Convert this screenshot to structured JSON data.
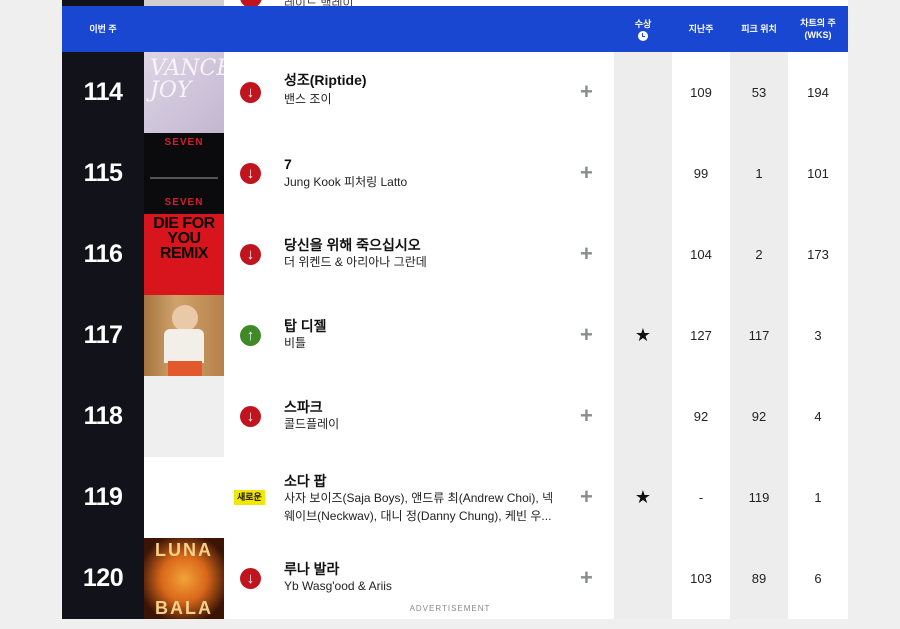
{
  "header": {
    "this_week": "이번 주",
    "award": "수상",
    "last_week": "지난주",
    "peak": "피크 위치",
    "weeks_line1": "차트의 주",
    "weeks_line2": "(WKS)"
  },
  "previous_row": {
    "artist": "레이드 백레이"
  },
  "rows": [
    {
      "rank": "114",
      "title": "성조(Riptide)",
      "artist": "밴스 조이",
      "trend": "down",
      "trend_icon": "arrow-down-icon",
      "award": "",
      "last_week": "109",
      "peak": "53",
      "weeks": "194",
      "art_text": "VANCE JOY"
    },
    {
      "rank": "115",
      "title": "7",
      "artist": "Jung Kook 피처링 Latto",
      "trend": "down",
      "trend_icon": "arrow-down-icon",
      "award": "",
      "last_week": "99",
      "peak": "1",
      "weeks": "101",
      "art_text": "SEVEN",
      "art_text2": "SEVEN"
    },
    {
      "rank": "116",
      "title": "당신을 위해 죽으십시오",
      "artist": "더 위켄드 & 아리아나 그란데",
      "trend": "down",
      "trend_icon": "arrow-down-icon",
      "award": "",
      "last_week": "104",
      "peak": "2",
      "weeks": "173",
      "art_text": "DIE FOR YOU REMIX"
    },
    {
      "rank": "117",
      "title": "탑 디젤",
      "artist": "비틀",
      "trend": "up",
      "trend_icon": "arrow-up-icon",
      "award": "★",
      "last_week": "127",
      "peak": "117",
      "weeks": "3"
    },
    {
      "rank": "118",
      "title": "스파크",
      "artist": "콜드플레이",
      "trend": "down",
      "trend_icon": "arrow-down-icon",
      "award": "",
      "last_week": "92",
      "peak": "92",
      "weeks": "4"
    },
    {
      "rank": "119",
      "title": "소다 팝",
      "artist": "사자 보이즈(Saja Boys), 앤드류 최(Andrew Choi), 넥웨이브(Neckwav), 대니 정(Danny Chung), 케빈 우...",
      "trend": "new",
      "new_label": "새로운",
      "award": "★",
      "last_week": "-",
      "peak": "119",
      "weeks": "1"
    },
    {
      "rank": "120",
      "title": "루나 발라",
      "artist": "Yb Wasg'ood & Ariis",
      "trend": "down",
      "trend_icon": "arrow-down-icon",
      "award": "",
      "last_week": "103",
      "peak": "89",
      "weeks": "6",
      "art_text": "LUNA",
      "art_text2": "BALA"
    }
  ],
  "colors": {
    "header_bg": "#1a47d1",
    "rank_bg": "#12131a",
    "down": "#c0151f",
    "up": "#3f8a26",
    "new_badge": "#f3e600"
  },
  "footer": {
    "advertisement": "ADVERTISEMENT"
  }
}
